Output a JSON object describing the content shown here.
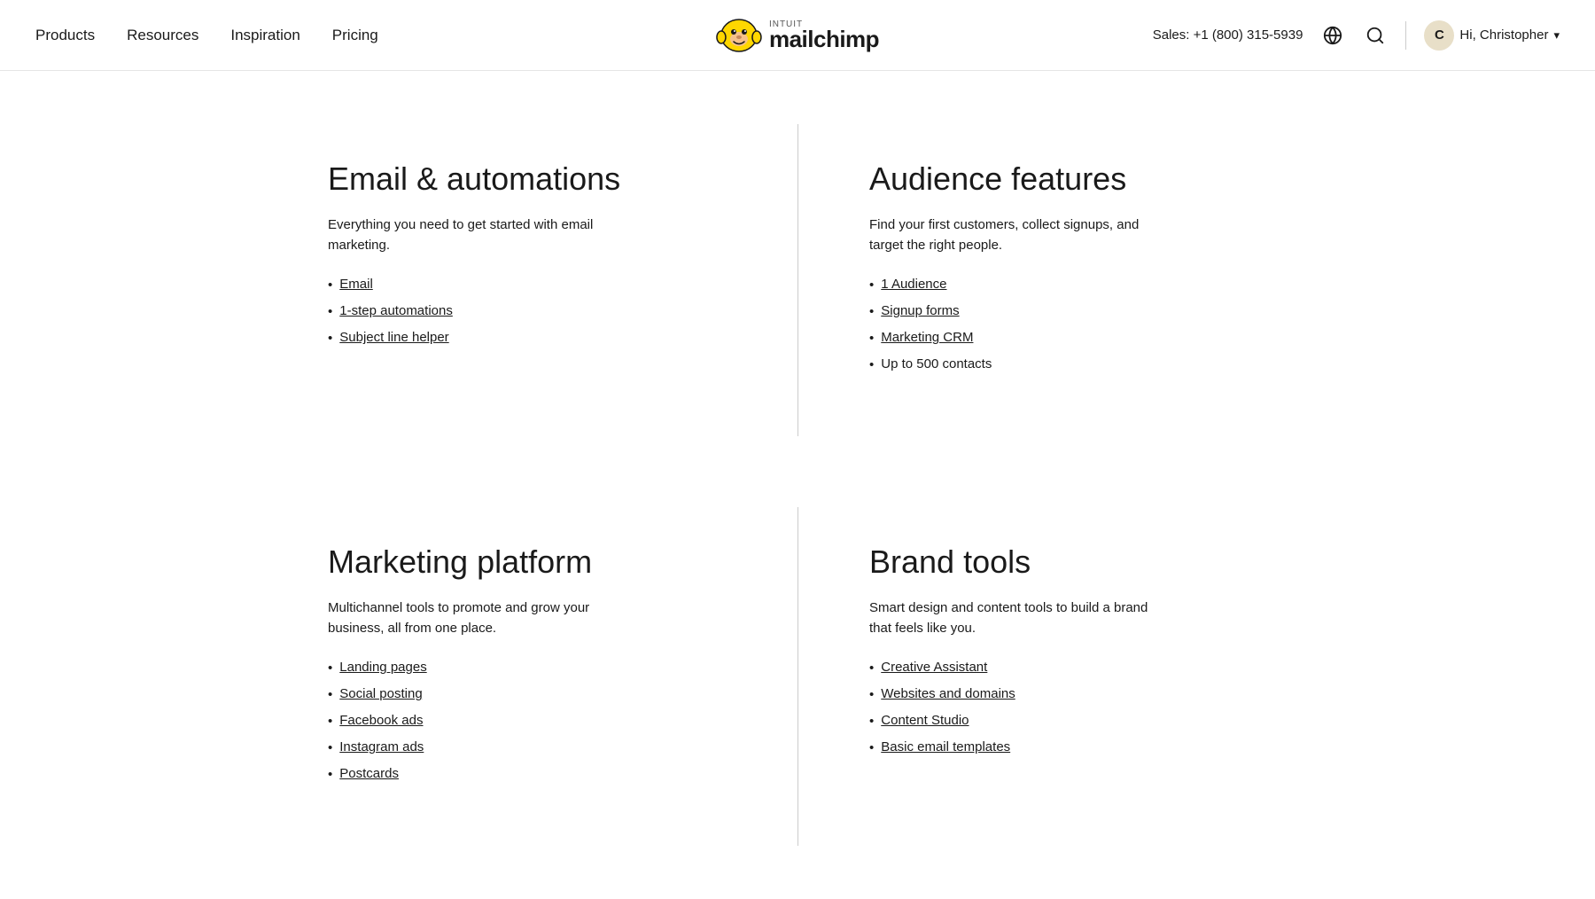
{
  "header": {
    "nav_left": [
      {
        "label": "Products",
        "id": "products"
      },
      {
        "label": "Resources",
        "id": "resources"
      },
      {
        "label": "Inspiration",
        "id": "inspiration"
      },
      {
        "label": "Pricing",
        "id": "pricing"
      }
    ],
    "logo_intuit": "INTUIT",
    "logo_main": "mailchimp",
    "sales_label": "Sales: +1 (800) 315-5939",
    "user_initial": "C",
    "user_greeting": "Hi, Christopher"
  },
  "sections": [
    {
      "id": "email-automations",
      "title": "Email & automations",
      "description": "Everything you need to get started with email marketing.",
      "links": [
        {
          "label": "Email",
          "href": true
        },
        {
          "label": "1-step automations",
          "href": true
        },
        {
          "label": "Subject line helper",
          "href": true
        }
      ]
    },
    {
      "id": "audience-features",
      "title": "Audience features",
      "description": "Find your first customers, collect signups, and target the right people.",
      "links": [
        {
          "label": "1 Audience",
          "href": true
        },
        {
          "label": "Signup forms",
          "href": true
        },
        {
          "label": "Marketing CRM",
          "href": true
        },
        {
          "label": "Up to 500 contacts",
          "href": false
        }
      ]
    },
    {
      "id": "marketing-platform",
      "title": "Marketing platform",
      "description": "Multichannel tools to promote and grow your business, all from one place.",
      "links": [
        {
          "label": "Landing pages",
          "href": true
        },
        {
          "label": "Social posting",
          "href": true
        },
        {
          "label": "Facebook ads",
          "href": true
        },
        {
          "label": "Instagram ads",
          "href": true
        },
        {
          "label": "Postcards",
          "href": true
        }
      ]
    },
    {
      "id": "brand-tools",
      "title": "Brand tools",
      "description": "Smart design and content tools to build a brand that feels like you.",
      "links": [
        {
          "label": "Creative Assistant",
          "href": true
        },
        {
          "label": "Websites and domains",
          "href": true
        },
        {
          "label": "Content Studio",
          "href": true
        },
        {
          "label": "Basic email templates",
          "href": true
        }
      ]
    }
  ]
}
